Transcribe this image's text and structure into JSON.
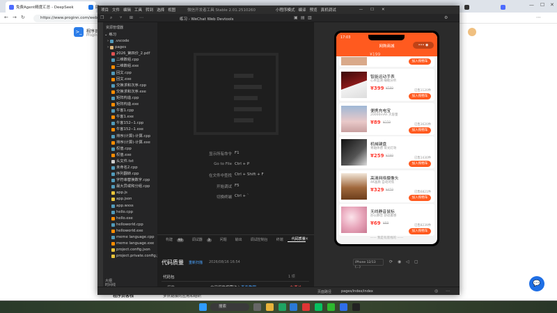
{
  "browser": {
    "tabs": [
      {
        "title": "免费Agent精度汇总 - DeepSeek",
        "color": "#4d6bfe"
      },
      {
        "title": "回上",
        "color": "#1a73e8"
      },
      {
        "title": "",
        "color": "#333333"
      },
      {
        "title": "",
        "color": "#4d6bfe"
      }
    ],
    "url": "https://www.proginn.com/web",
    "page_brand": "程序员",
    "page_brand_sub": "Progin",
    "bottom_text": "程序员客栈",
    "bottom_text2": "多点链接的应用和组织"
  },
  "devtools": {
    "title": "练习 - WeChat Web Devtools",
    "version_label": "微信开发者工具 Stable 2.01.2510260",
    "menu": [
      "项目",
      "文件",
      "编辑",
      "工具",
      "转到",
      "选择",
      "视图"
    ],
    "mode_label": "小程序模式",
    "actions": [
      "编译",
      "预览",
      "真机调试"
    ],
    "explorer_title": "资源管理器",
    "root": "练习",
    "folders": [
      ".vscode",
      "pages"
    ],
    "files": [
      {
        "name": "2026_第四价_2.pdf",
        "color": "#e05252"
      },
      {
        "name": "二维数组.cpp",
        "color": "#519aba"
      },
      {
        "name": "二维数组.exe",
        "color": "#ff8c00"
      },
      {
        "name": "回文.cpp",
        "color": "#519aba"
      },
      {
        "name": "回文.exe",
        "color": "#ff8c00"
      },
      {
        "name": "交换求和次序.cpp",
        "color": "#519aba"
      },
      {
        "name": "交换求和次序.exe",
        "color": "#ff8c00"
      },
      {
        "name": "矩阵构造.cpp",
        "color": "#519aba"
      },
      {
        "name": "矩阵构造.exe",
        "color": "#ff8c00"
      },
      {
        "name": "牛客1.cpp",
        "color": "#519aba"
      },
      {
        "name": "牛客1.exe",
        "color": "#ff8c00"
      },
      {
        "name": "牛客152--1.cpp",
        "color": "#519aba"
      },
      {
        "name": "牛客152--1.exe",
        "color": "#ff8c00"
      },
      {
        "name": "排序(计算)-计算.cpp",
        "color": "#519aba"
      },
      {
        "name": "排序(计算)-计算.exe",
        "color": "#ff8c00"
      },
      {
        "name": "权值.cpp",
        "color": "#519aba"
      },
      {
        "name": "权值.exe",
        "color": "#ff8c00"
      },
      {
        "name": "头文件.txt",
        "color": "#cccccc"
      },
      {
        "name": "未命名2.cpp",
        "color": "#519aba"
      },
      {
        "name": "序列翻转.cpp",
        "color": "#519aba"
      },
      {
        "name": "字符串替换数字.cpp",
        "color": "#519aba"
      },
      {
        "name": "最大异或和分组.cpp",
        "color": "#519aba"
      },
      {
        "name": "app.js",
        "color": "#e8c33a"
      },
      {
        "name": "app.json",
        "color": "#e8c33a"
      },
      {
        "name": "app.wxss",
        "color": "#519aba"
      },
      {
        "name": "hello.cpp",
        "color": "#519aba"
      },
      {
        "name": "hello.exe",
        "color": "#ff8c00"
      },
      {
        "name": "helloworld.cpp",
        "color": "#519aba"
      },
      {
        "name": "helloworld.exe",
        "color": "#ff8c00"
      },
      {
        "name": "meme language.cpp",
        "color": "#519aba"
      },
      {
        "name": "meme language.exe",
        "color": "#ff8c00"
      },
      {
        "name": "project.config.json",
        "color": "#e8c33a"
      },
      {
        "name": "project.private.config.js",
        "color": "#e8c33a"
      }
    ],
    "outline_items": [
      "大纲",
      "时间线"
    ],
    "commands": [
      {
        "label": "显示所有命令",
        "keys": "F1"
      },
      {
        "label": "Go to File",
        "keys": "Ctrl + P"
      },
      {
        "label": "在文件中查找",
        "keys": "Ctrl + Shift + F"
      },
      {
        "label": "开始调试",
        "keys": "F5"
      },
      {
        "label": "切换终端",
        "keys": "Ctrl + `"
      }
    ],
    "panel": {
      "tabs": [
        {
          "label": "构建",
          "badge": "93"
        },
        {
          "label": "调试器",
          "badge": "3"
        },
        {
          "label": "问题",
          "badge": ""
        },
        {
          "label": "输出",
          "badge": ""
        },
        {
          "label": "调试控制台",
          "badge": ""
        },
        {
          "label": "终端",
          "badge": ""
        },
        {
          "label": "代码质量",
          "badge": ""
        }
      ],
      "quality_title": "代码质量",
      "rescan": "重新扫描",
      "date": "2026/08/16 16:54",
      "row1_label": "代码包",
      "row1_value": "1 项",
      "row2_label": "组件",
      "row2_desc": "启用组件按需注入",
      "row2_link": "查看教程",
      "row2_status": "未通过"
    },
    "status_path": "pages/index/index",
    "status_label": "页面路径"
  },
  "simulator": {
    "time": "17:03",
    "app_title": "网购商城",
    "device": "iPhone 12/13 (...)",
    "footer": "—— 我是有底线的 ——",
    "products": [
      {
        "name": "智能运动手表",
        "desc": "心率监测 睡眠分析",
        "price": "¥399",
        "orig": "¥599",
        "sold": "已售1120件",
        "btn": "加入购物车",
        "img": "shoe"
      },
      {
        "name": "便携充电宝",
        "desc": "20000mAh 大容量",
        "price": "¥89",
        "orig": "¥159",
        "sold": "已售3620件",
        "btn": "加入购物车",
        "img": "sky"
      },
      {
        "name": "机械键盘",
        "desc": "青轴体感 背光灯效",
        "price": "¥259",
        "orig": "¥399",
        "sold": "已售1430件",
        "btn": "加入购物车",
        "img": "bw"
      },
      {
        "name": "高清网络摄像头",
        "desc": "4K画质 自动对焦",
        "price": "¥329",
        "orig": "¥459",
        "sold": "已售6821件",
        "btn": "加入购物车",
        "img": "brown"
      },
      {
        "name": "无线静音鼠标",
        "desc": "办公静音 舒适握感",
        "price": "¥69",
        "orig": "¥99",
        "sold": "已售8239件",
        "btn": "加入购物车",
        "img": "pink"
      }
    ],
    "top_price": "¥199"
  },
  "taskbar": {
    "search_placeholder": "搜索"
  }
}
